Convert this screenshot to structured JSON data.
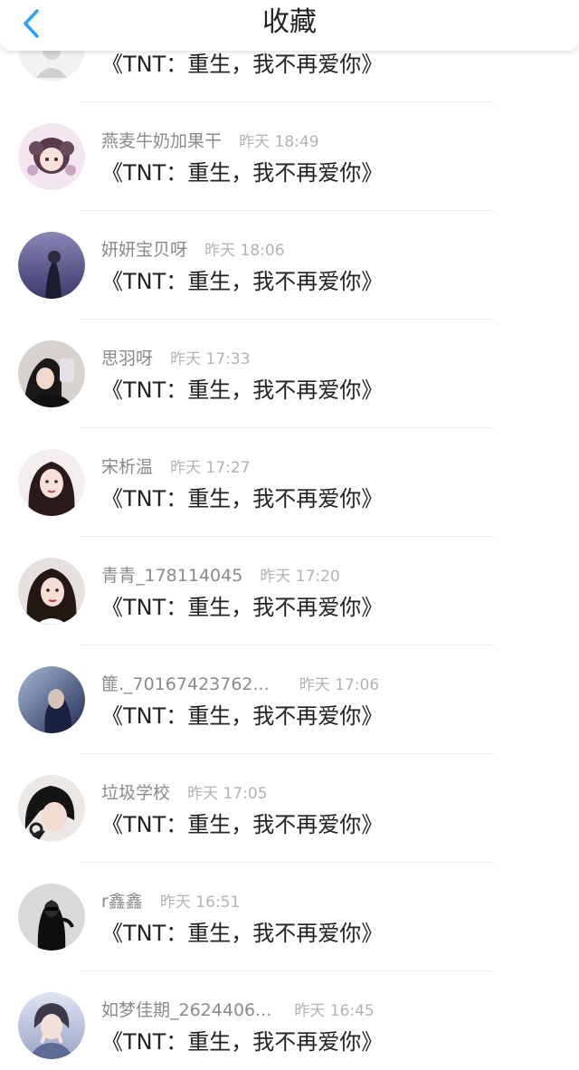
{
  "header": {
    "title": "收藏"
  },
  "items": [
    {
      "name": "",
      "time": "",
      "title": "《TNT：重生，我不再爱你》"
    },
    {
      "name": "燕麦牛奶加果干",
      "time": "昨天 18:49",
      "title": "《TNT：重生，我不再爱你》"
    },
    {
      "name": "妍妍宝贝呀",
      "time": "昨天 18:06",
      "title": "《TNT：重生，我不再爱你》"
    },
    {
      "name": "思羽呀",
      "time": "昨天 17:33",
      "title": "《TNT：重生，我不再爱你》"
    },
    {
      "name": "宋析温",
      "time": "昨天 17:27",
      "title": "《TNT：重生，我不再爱你》"
    },
    {
      "name": "青青_178114045",
      "time": "昨天 17:20",
      "title": "《TNT：重生，我不再爱你》"
    },
    {
      "name": "篚._70167423762...",
      "time": "昨天 17:06",
      "title": "《TNT：重生，我不再爱你》"
    },
    {
      "name": "垃圾学校",
      "time": "昨天 17:05",
      "title": "《TNT：重生，我不再爱你》"
    },
    {
      "name": "r鑫鑫",
      "time": "昨天 16:51",
      "title": "《TNT：重生，我不再爱你》"
    },
    {
      "name": "如梦佳期_2624406...",
      "time": "昨天 16:45",
      "title": "《TNT：重生，我不再爱你》"
    }
  ],
  "colors": {
    "accent": "#2aa3f0",
    "name": "#8a8a8a",
    "time": "#b3b3b3",
    "title": "#222222"
  }
}
